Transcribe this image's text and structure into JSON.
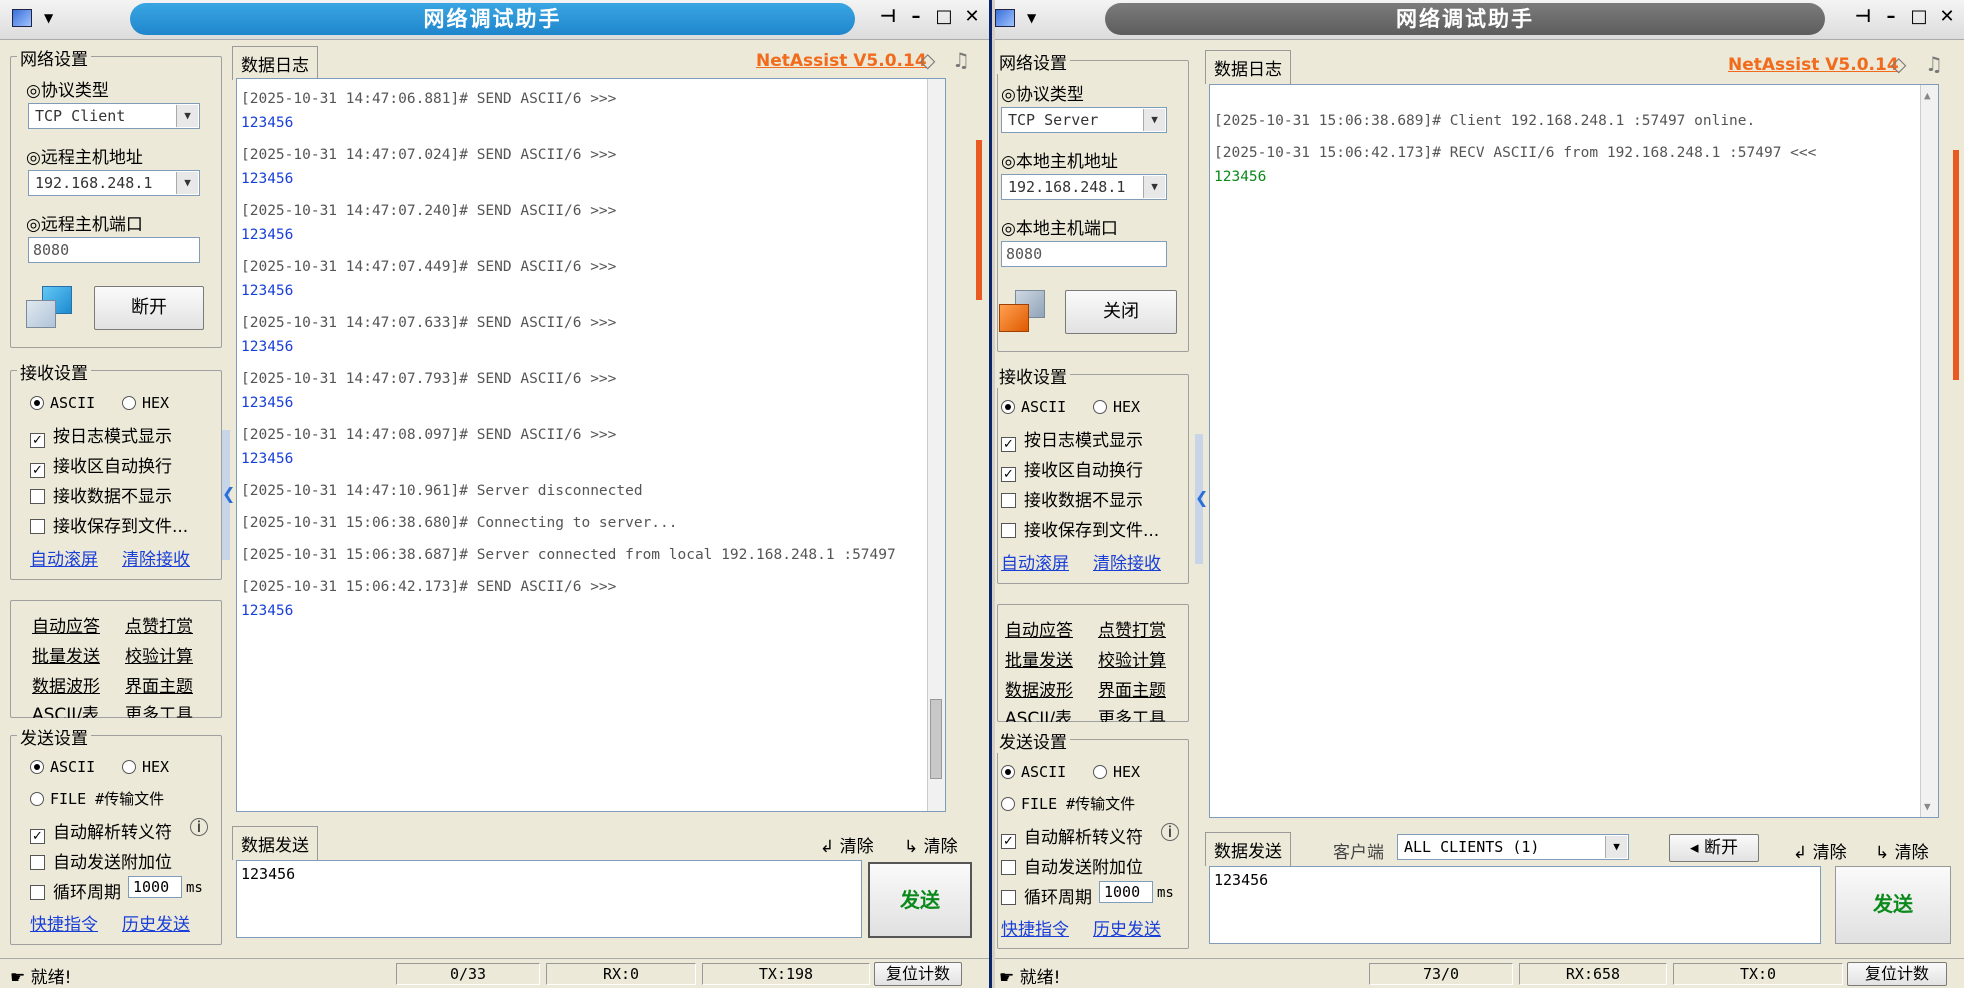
{
  "left": {
    "title": "网络调试助手",
    "network_settings": {
      "title": "网络设置",
      "protocol_label": "◎协议类型",
      "protocol_value": "TCP Client",
      "host_label": "◎远程主机地址",
      "host_value": "192.168.248.1",
      "port_label": "◎远程主机端口",
      "port_value": "8080",
      "connect_button": "断开"
    },
    "receive_settings": {
      "title": "接收设置",
      "ascii": "ASCII",
      "hex": "HEX",
      "log_mode": "按日志模式显示",
      "auto_wrap": "接收区自动换行",
      "hide_data": "接收数据不显示",
      "save_file": "接收保存到文件...",
      "auto_scroll": "自动滚屏",
      "clear_recv": "清除接收"
    },
    "tools": [
      "自动应答",
      "点赞打赏",
      "批量发送",
      "校验计算",
      "数据波形",
      "界面主题",
      "ASCII/表",
      "更多工具"
    ],
    "send_settings": {
      "title": "发送设置",
      "ascii": "ASCII",
      "hex": "HEX",
      "file": "FILE #传输文件",
      "auto_escape": "自动解析转义符",
      "append": "自动发送附加位",
      "cycle": "循环周期",
      "cycle_value": "1000",
      "cycle_unit": "ms",
      "shortcuts": "快捷指令",
      "history": "历史发送"
    },
    "log_tab": "数据日志",
    "brand": "NetAssist V5.0.14",
    "log": [
      {
        "h": "[2025-10-31 14:47:06.881]# SEND ASCII/6 >>>",
        "d": "123456"
      },
      {
        "h": "[2025-10-31 14:47:07.024]# SEND ASCII/6 >>>",
        "d": "123456"
      },
      {
        "h": "[2025-10-31 14:47:07.240]# SEND ASCII/6 >>>",
        "d": "123456"
      },
      {
        "h": "[2025-10-31 14:47:07.449]# SEND ASCII/6 >>>",
        "d": "123456"
      },
      {
        "h": "[2025-10-31 14:47:07.633]# SEND ASCII/6 >>>",
        "d": "123456"
      },
      {
        "h": "[2025-10-31 14:47:07.793]# SEND ASCII/6 >>>",
        "d": "123456"
      },
      {
        "h": "[2025-10-31 14:47:08.097]# SEND ASCII/6 >>>",
        "d": "123456"
      },
      {
        "h": "[2025-10-31 14:47:10.961]# Server disconnected",
        "d": ""
      },
      {
        "h": "[2025-10-31 15:06:38.680]# Connecting to server...",
        "d": ""
      },
      {
        "h": "[2025-10-31 15:06:38.687]# Server connected from local 192.168.248.1 :57497",
        "d": ""
      },
      {
        "h": "[2025-10-31 15:06:42.173]# SEND ASCII/6 >>>",
        "d": "123456"
      }
    ],
    "send_tab": "数据发送",
    "clear1": "清除",
    "clear2": "清除",
    "send_text": "123456",
    "send_button": "发送",
    "status": {
      "ready": "就绪!",
      "count": "0/33",
      "rx": "RX:0",
      "tx": "TX:198",
      "reset": "复位计数"
    }
  },
  "right": {
    "title": "网络调试助手",
    "network_settings": {
      "title": "网络设置",
      "protocol_label": "◎协议类型",
      "protocol_value": "TCP Server",
      "host_label": "◎本地主机地址",
      "host_value": "192.168.248.1",
      "port_label": "◎本地主机端口",
      "port_value": "8080",
      "connect_button": "关闭"
    },
    "receive_settings": {
      "title": "接收设置",
      "ascii": "ASCII",
      "hex": "HEX",
      "log_mode": "按日志模式显示",
      "auto_wrap": "接收区自动换行",
      "hide_data": "接收数据不显示",
      "save_file": "接收保存到文件...",
      "auto_scroll": "自动滚屏",
      "clear_recv": "清除接收"
    },
    "tools": [
      "自动应答",
      "点赞打赏",
      "批量发送",
      "校验计算",
      "数据波形",
      "界面主题",
      "ASCII/表",
      "更多工具"
    ],
    "send_settings": {
      "title": "发送设置",
      "ascii": "ASCII",
      "hex": "HEX",
      "file": "FILE #传输文件",
      "auto_escape": "自动解析转义符",
      "append": "自动发送附加位",
      "cycle": "循环周期",
      "cycle_value": "1000",
      "cycle_unit": "ms",
      "shortcuts": "快捷指令",
      "history": "历史发送"
    },
    "log_tab": "数据日志",
    "brand": "NetAssist V5.0.14",
    "log": [
      {
        "h": "[2025-10-31 15:06:38.689]# Client 192.168.248.1 :57497 online.",
        "d": ""
      },
      {
        "h": "[2025-10-31 15:06:42.173]# RECV ASCII/6 from 192.168.248.1 :57497 <<<",
        "d": "123456"
      }
    ],
    "send_tab": "数据发送",
    "client_label": "客户端",
    "client_value": "ALL CLIENTS (1)",
    "disconnect": "断开",
    "clear1": "清除",
    "clear2": "清除",
    "send_text": "123456",
    "send_button": "发送",
    "status": {
      "ready": "就绪!",
      "count": "73/0",
      "rx": "RX:658",
      "tx": "TX:0",
      "reset": "复位计数"
    }
  }
}
